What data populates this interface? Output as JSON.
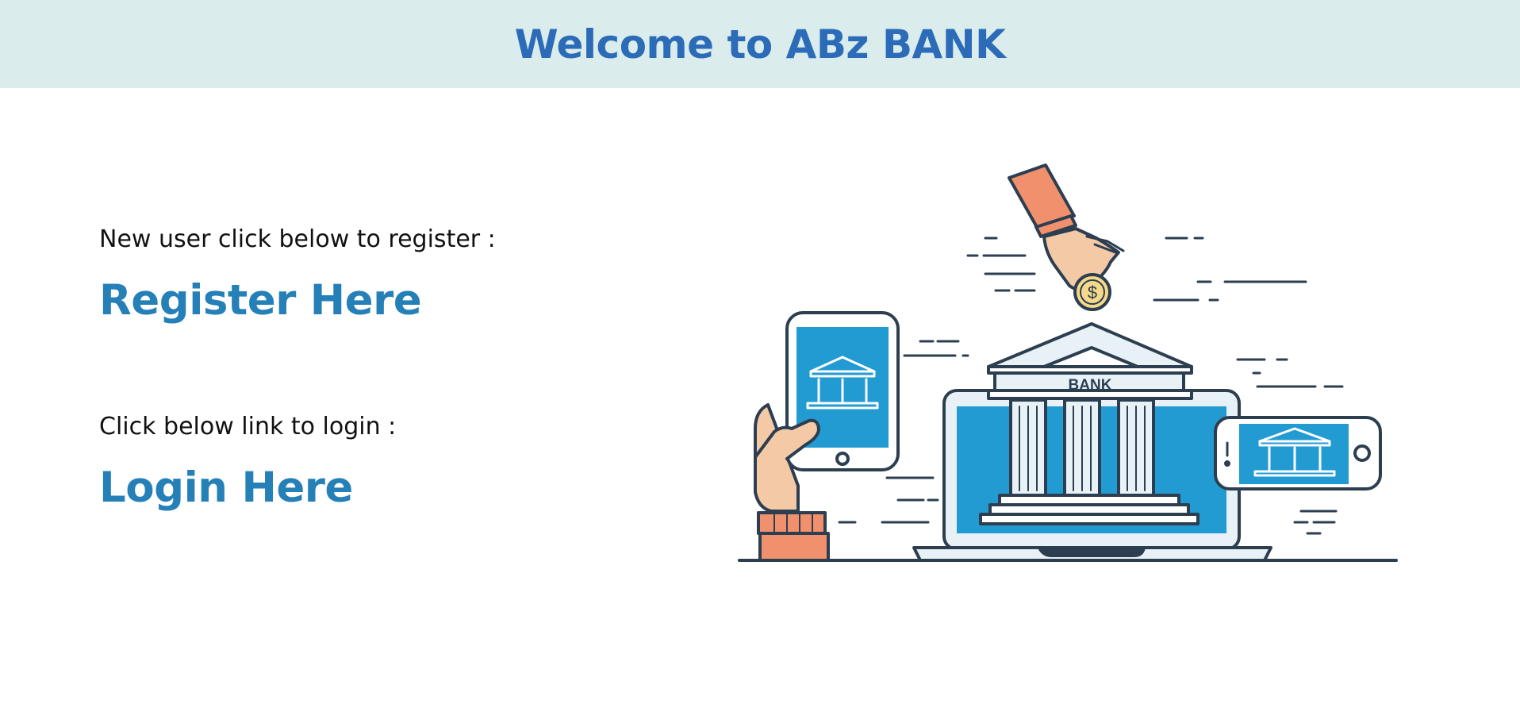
{
  "header": {
    "title": "Welcome to ABz BANK"
  },
  "register": {
    "prompt": "New user click below to register :",
    "link_label": "Register Here"
  },
  "login": {
    "prompt": "Click below link to login :",
    "link_label": "Login Here"
  },
  "illustration": {
    "bank_sign": "BANK",
    "coin_symbol": "$",
    "icon": "online-banking-illustration"
  },
  "colors": {
    "header_bg": "#daeceb",
    "title": "#2b6bb8",
    "link": "#2580b8",
    "screen_blue": "#229bd3",
    "outline": "#2c3e50",
    "skin": "#f3c9a6",
    "sleeve": "#f0906c"
  }
}
